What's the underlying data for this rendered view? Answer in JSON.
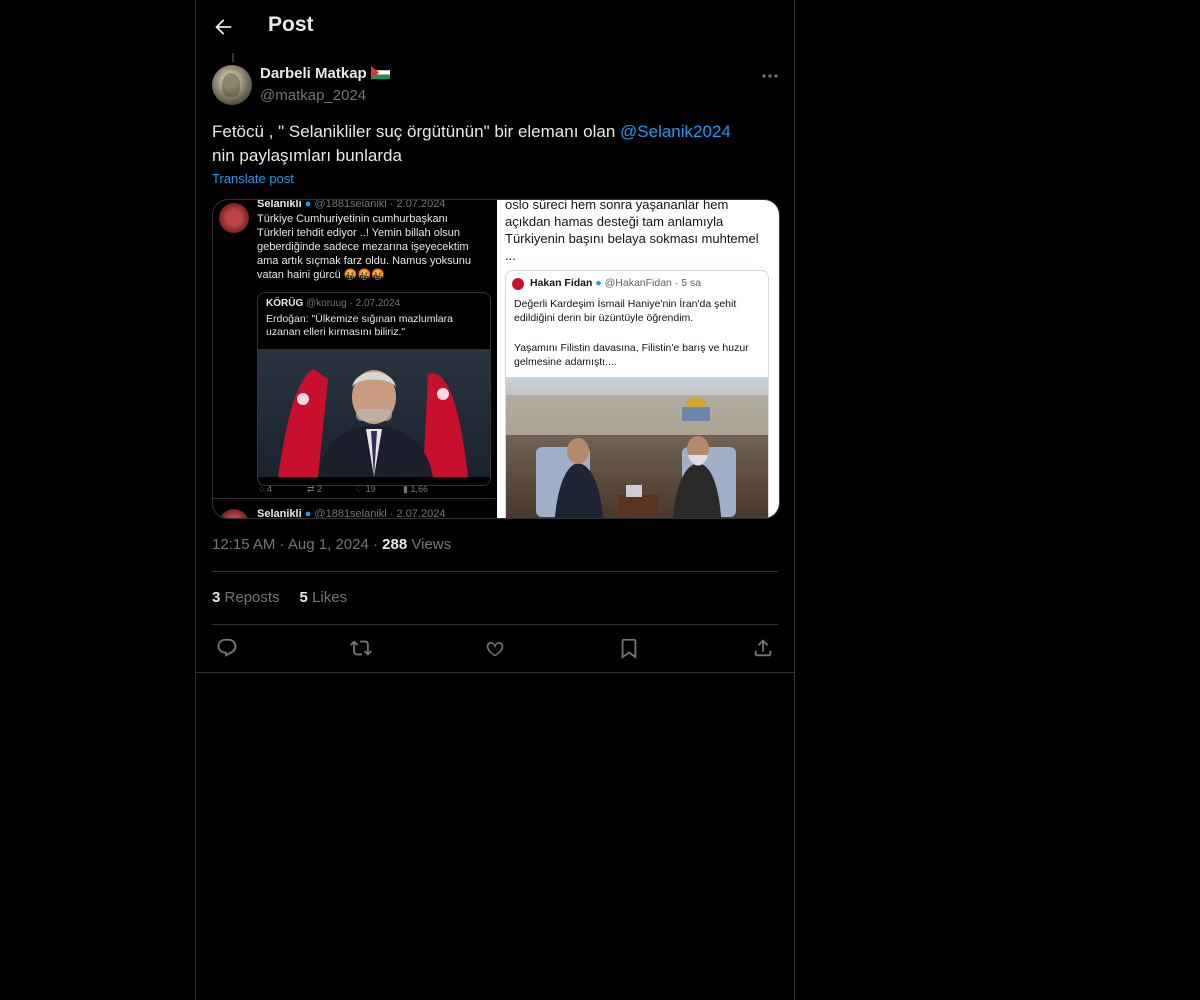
{
  "header": {
    "title": "Post"
  },
  "post": {
    "display_name": "Darbeli Matkap",
    "handle": "@matkap_2024",
    "text_before": "Fetöcü , \" Selanikliler suç örgütünün\" bir elemanı olan ",
    "mention": "@Selanik2024",
    "text_after": " nin paylaşımları bunlarda",
    "translate_label": "Translate post",
    "time": "12:15 AM",
    "date": "Aug 1, 2024",
    "views_count": "288",
    "views_label": "Views",
    "reposts_count": "3",
    "reposts_label": "Reposts",
    "likes_count": "5",
    "likes_label": "Likes"
  },
  "media_left": {
    "name": "Selanikli",
    "handle_date": "@1881selanikl · 2.07.2024",
    "text": "Türkiye Cumhuriyetinin cumhurbaşkanı Türkleri tehdit ediyor ..! Yemin billah olsun geberdiğinde sadece mezarına işeyecektim ama artık sıçmak farz oldu. Namus yoksunu vatan haini gürcü 🤬🤬🤬",
    "quote_name": "KÖRÜG",
    "quote_handle": "@koruug · 2.07.2024",
    "quote_text": "Erdoğan: \"Ülkemize sığınan mazlumlara uzanan elleri kırmasını biliriz.\"",
    "replies": "4",
    "reposts": "2",
    "likes": "19",
    "views": "1,66",
    "next_name": "Selanikli",
    "next_handle": "@1881selanikl · 2.07.2024"
  },
  "media_right": {
    "text": "oslo süreci hem sonra yaşananlar hem açıkdan hamas desteği tam anlamıyla Türkiyenin başını belaya sokması muhtemel ...",
    "quote_name": "Hakan Fidan",
    "quote_handle": "@HakanFidan · 5 sa",
    "quote_text_1": "Değerli Kardeşim İsmail Haniye'nin İran'da şehit edildiğini derin bir üzüntüyle öğrendim.",
    "quote_text_2": "Yaşamını Filistin davasına, Filistin'e barış ve huzur gelmesine adamıştı...."
  },
  "colors": {
    "accent": "#1d9bf0",
    "muted": "#71767b",
    "text": "#e7e9ea",
    "border": "#2f3336"
  },
  "icons": [
    "back-arrow-icon",
    "more-icon",
    "reply-icon",
    "repost-icon",
    "like-icon",
    "bookmark-icon",
    "share-icon",
    "palestine-flag-icon"
  ]
}
